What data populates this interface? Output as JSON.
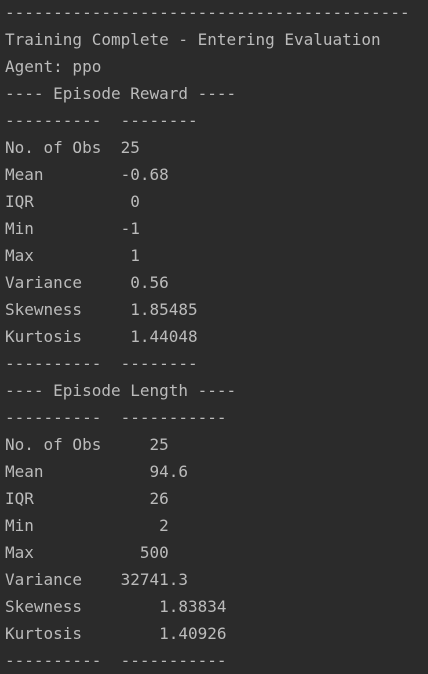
{
  "terminal": {
    "lines": [
      "------------------------------------------",
      "Training Complete - Entering Evaluation",
      "Agent: ppo",
      "---- Episode Reward ----",
      "----------  --------",
      "No. of Obs  25",
      "Mean        -0.68",
      "IQR          0",
      "Min         -1",
      "Max          1",
      "Variance     0.56",
      "Skewness     1.85485",
      "Kurtosis     1.44048",
      "----------  --------",
      "---- Episode Length ----",
      "----------  -----------",
      "No. of Obs     25",
      "Mean           94.6",
      "IQR            26",
      "Min             2",
      "Max           500",
      "Variance    32741.3",
      "Skewness        1.83834",
      "Kurtosis        1.40926",
      "----------  -----------"
    ]
  },
  "colors": {
    "background": "#2b2b2b",
    "text": "#bbbbbb"
  }
}
